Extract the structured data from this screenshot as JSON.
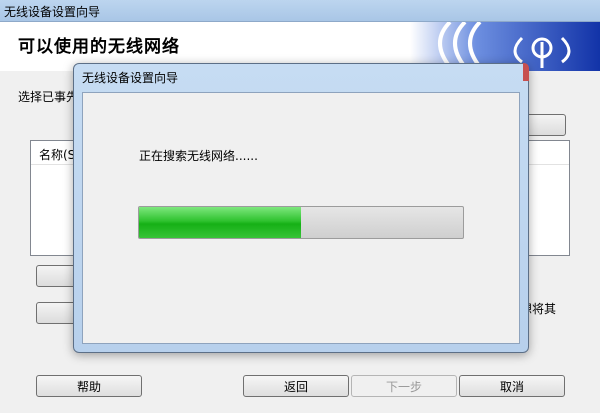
{
  "window": {
    "title": "无线设备设置向导"
  },
  "banner": {
    "title": "可以使用的无线网络",
    "logo_icon": "wireless-signal-icon"
  },
  "instruction": "选择已事先",
  "list": {
    "header_name": "名称(S"
  },
  "right_text": "想将其",
  "buttons": {
    "help": "帮助",
    "back": "返回",
    "next": "下一步",
    "cancel": "取消"
  },
  "dialog": {
    "title": "无线设备设置向导",
    "status": "正在搜索无线网络......",
    "progress": 0.5
  },
  "colors": {
    "progress_green": "#22bb22",
    "banner_blue": "#1a3fb0"
  }
}
